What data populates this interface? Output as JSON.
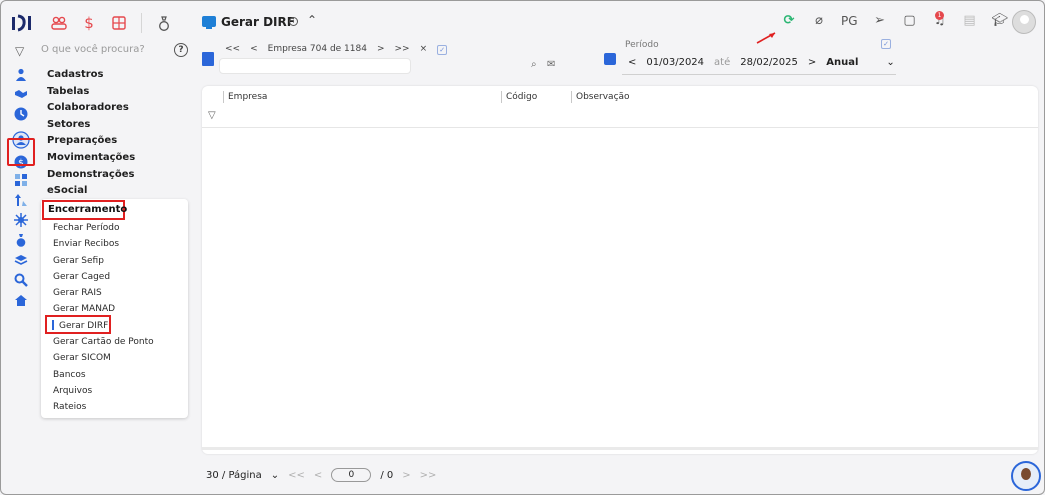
{
  "header": {
    "top_icons": [
      "users-icon",
      "dollar-icon",
      "calculator-icon",
      "money-bag-icon"
    ],
    "title": "Gerar DIRF",
    "right_tools": {
      "pg_label": "PG",
      "notification_count": "1"
    }
  },
  "sidebar": {
    "search_placeholder": "O que você procura?",
    "help": "?",
    "menu": [
      "Cadastros",
      "Tabelas",
      "Colaboradores",
      "Setores",
      "Preparações",
      "Movimentações",
      "Demonstrações",
      "eSocial"
    ],
    "section_title": "Encerramento",
    "submenu": [
      "Fechar Período",
      "Enviar Recibos",
      "Gerar Sefip",
      "Gerar Caged",
      "Gerar RAIS",
      "Gerar MANAD",
      "Gerar DIRF",
      "Gerar Cartão de Ponto",
      "Gerar SICOM",
      "Bancos",
      "Arquivos",
      "Rateios"
    ]
  },
  "company_nav": {
    "first": "<<",
    "prev": "<",
    "label": "Empresa 704 de 1184",
    "next": ">",
    "last": ">>",
    "clear": "×",
    "input_value": ""
  },
  "period": {
    "label": "Período",
    "prev": "<",
    "start": "01/03/2024",
    "separator": "até",
    "end": "28/02/2025",
    "next": ">",
    "type": "Anual"
  },
  "grid": {
    "columns": [
      "Empresa",
      "Código",
      "Observação"
    ]
  },
  "footer": {
    "page_size": "30 / Página",
    "first": "<<",
    "prev": "<",
    "page": "0",
    "total": "/ 0",
    "next": ">",
    "last": ">>"
  },
  "colors": {
    "accent": "#2b66d9",
    "danger": "#e5484d",
    "success": "#2bb673",
    "highlight_box": "#e02020"
  }
}
